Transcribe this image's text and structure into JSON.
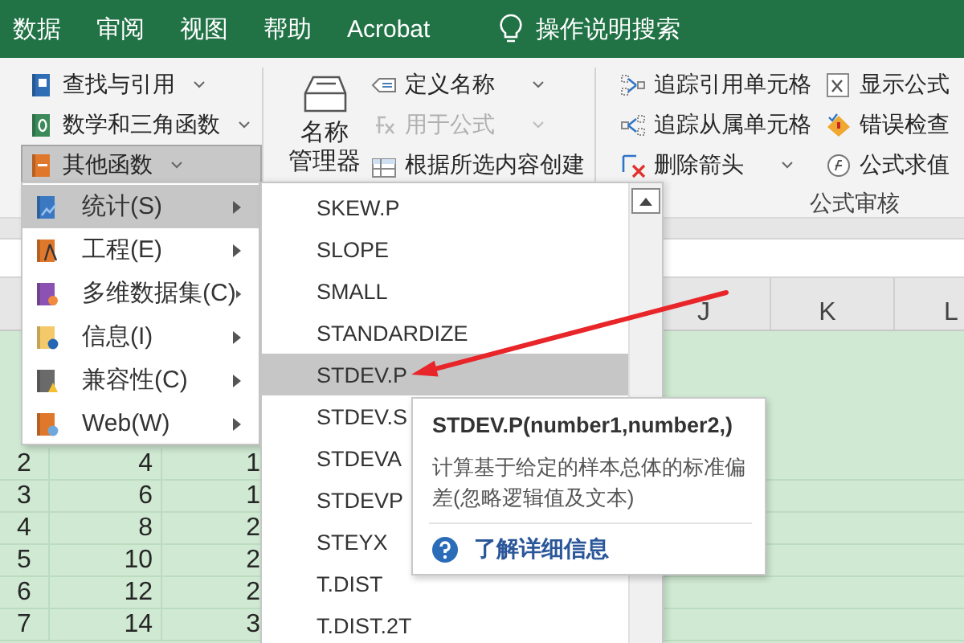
{
  "ribbon_tabs": [
    {
      "label": "数据"
    },
    {
      "label": "审阅"
    },
    {
      "label": "视图"
    },
    {
      "label": "帮助"
    },
    {
      "label": "Acrobat"
    }
  ],
  "tell_me": {
    "label": "操作说明搜索"
  },
  "function_library": {
    "buttons": [
      {
        "label": "查找与引用",
        "kind": "lookup",
        "pressed": false
      },
      {
        "label": "数学和三角函数",
        "kind": "math",
        "pressed": false
      },
      {
        "label": "其他函数",
        "kind": "more",
        "pressed": true
      }
    ]
  },
  "defined_names": {
    "name_manager": [
      "名称",
      "管理器"
    ],
    "items": [
      {
        "label": "定义名称",
        "kind": "define",
        "disabled": false,
        "dropdown": true
      },
      {
        "label": "用于公式",
        "kind": "use",
        "disabled": true,
        "dropdown": true
      },
      {
        "label": "根据所选内容创建",
        "kind": "create",
        "disabled": false,
        "dropdown": false
      }
    ]
  },
  "formula_auditing": {
    "label": "公式审核",
    "columns": [
      [
        {
          "label": "追踪引用单元格",
          "kind": "precedents"
        },
        {
          "label": "追踪从属单元格",
          "kind": "dependents"
        },
        {
          "label": "删除箭头",
          "kind": "remove",
          "dropdown": true
        }
      ],
      [
        {
          "label": "显示公式",
          "kind": "show"
        },
        {
          "label": "错误检查",
          "kind": "error"
        },
        {
          "label": "公式求值",
          "kind": "evaluate"
        }
      ]
    ]
  },
  "sheet": {
    "columns": [
      {
        "label": "J"
      },
      {
        "label": "K"
      },
      {
        "label": "L"
      }
    ],
    "rows": [
      {
        "number": "2",
        "cells": [
          "4",
          "1"
        ]
      },
      {
        "number": "3",
        "cells": [
          "6",
          "1"
        ]
      },
      {
        "number": "4",
        "cells": [
          "8",
          "2"
        ]
      },
      {
        "number": "5",
        "cells": [
          "10",
          "2"
        ]
      },
      {
        "number": "6",
        "cells": [
          "12",
          "2"
        ]
      },
      {
        "number": "7",
        "cells": [
          "14",
          "3"
        ]
      }
    ]
  },
  "category_menu": {
    "items": [
      {
        "label": "统计(S)",
        "kind": "statistical",
        "selected": true
      },
      {
        "label": "工程(E)",
        "kind": "engineering",
        "selected": false
      },
      {
        "label": "多维数据集(C)",
        "kind": "cube",
        "selected": false
      },
      {
        "label": "信息(I)",
        "kind": "information",
        "selected": false
      },
      {
        "label": "兼容性(C)",
        "kind": "compatibility",
        "selected": false
      },
      {
        "label": "Web(W)",
        "kind": "web",
        "selected": false
      }
    ]
  },
  "function_menu": {
    "items": [
      {
        "label": "SKEW.P",
        "selected": false
      },
      {
        "label": "SLOPE",
        "selected": false
      },
      {
        "label": "SMALL",
        "selected": false
      },
      {
        "label": "STANDARDIZE",
        "selected": false
      },
      {
        "label": "STDEV.P",
        "selected": true
      },
      {
        "label": "STDEV.S",
        "selected": false
      },
      {
        "label": "STDEVA",
        "selected": false
      },
      {
        "label": "STDEVP",
        "selected": false
      },
      {
        "label": "STEYX",
        "selected": false
      },
      {
        "label": "T.DIST",
        "selected": false
      },
      {
        "label": "T.DIST.2T",
        "selected": false
      }
    ]
  },
  "tooltip": {
    "signature": "STDEV.P(number1,number2,)",
    "description": "计算基于给定的样本总体的标准偏差(忽略逻辑值及文本)",
    "link": "了解详细信息"
  }
}
